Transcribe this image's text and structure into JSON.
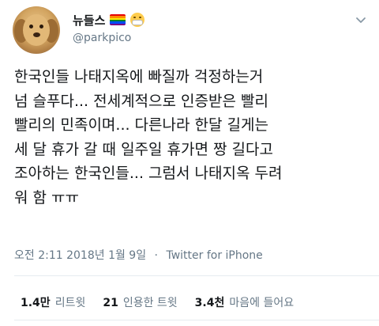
{
  "user": {
    "display_name": "뉴들스",
    "handle": "@parkpico",
    "flag_colors": [
      "#e40303",
      "#ff8c00",
      "#ffed00",
      "#008026",
      "#004dff",
      "#750787"
    ]
  },
  "icons": {
    "flag": "rainbow-flag-icon",
    "mask": "medical-mask-face-icon",
    "caret": "chevron-down-icon"
  },
  "tweet": {
    "text": "한국인들 나태지옥에 빠질까 걱정하는거\n넘 슬푸다... 전세계적으로 인증받은 빨리\n빨리의 민족이며... 다른나라 한달 길게는\n세 달 휴가 갈 때 일주일 휴가면 짱 길다고\n조아하는 한국인들... 그럼서 나태지옥 두려\n워 함 ㅠㅠ"
  },
  "meta": {
    "time": "오전 2:11",
    "date": "2018년 1월 9일",
    "separator": "·",
    "client": "Twitter for iPhone"
  },
  "stats": {
    "retweets_count": "1.4만",
    "retweets_label": "리트윗",
    "quotes_count": "21",
    "quotes_label": "인용한 트윗",
    "likes_count": "3.4천",
    "likes_label": "마음에 들어요"
  }
}
